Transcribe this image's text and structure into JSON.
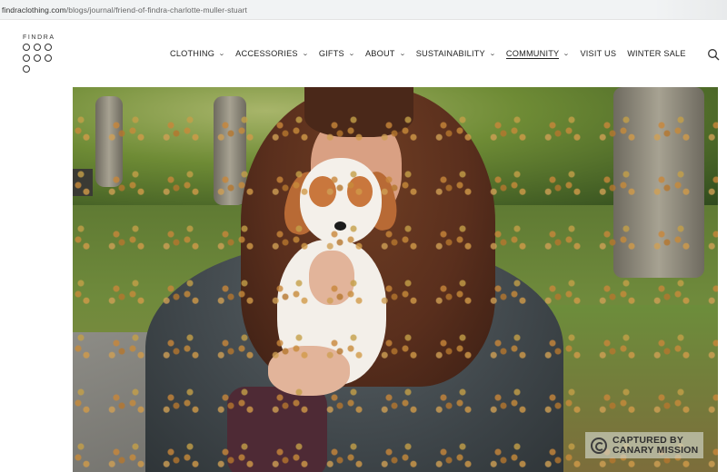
{
  "browser": {
    "url_host": "findraclothing.com",
    "url_path": "/blogs/journal/friend-of-findra-charlotte-muller-stuart"
  },
  "header": {
    "logo_text": "FINDRA",
    "nav": [
      {
        "label": "CLOTHING",
        "has_dropdown": true
      },
      {
        "label": "ACCESSORIES",
        "has_dropdown": true
      },
      {
        "label": "GIFTS",
        "has_dropdown": true
      },
      {
        "label": "ABOUT",
        "has_dropdown": true
      },
      {
        "label": "SUSTAINABILITY",
        "has_dropdown": true
      },
      {
        "label": "COMMUNITY",
        "has_dropdown": true,
        "active": true
      },
      {
        "label": "VISIT US",
        "has_dropdown": false
      },
      {
        "label": "WINTER SALE",
        "has_dropdown": false
      }
    ],
    "search_icon": "search-icon"
  },
  "hero": {
    "image_subject": "woman holding puppy in park",
    "watermark": {
      "line1": "CAPTURED BY",
      "line2": "CANARY MISSION"
    }
  },
  "colors": {
    "text": "#222222",
    "url_bar": "#f1f3f4"
  }
}
